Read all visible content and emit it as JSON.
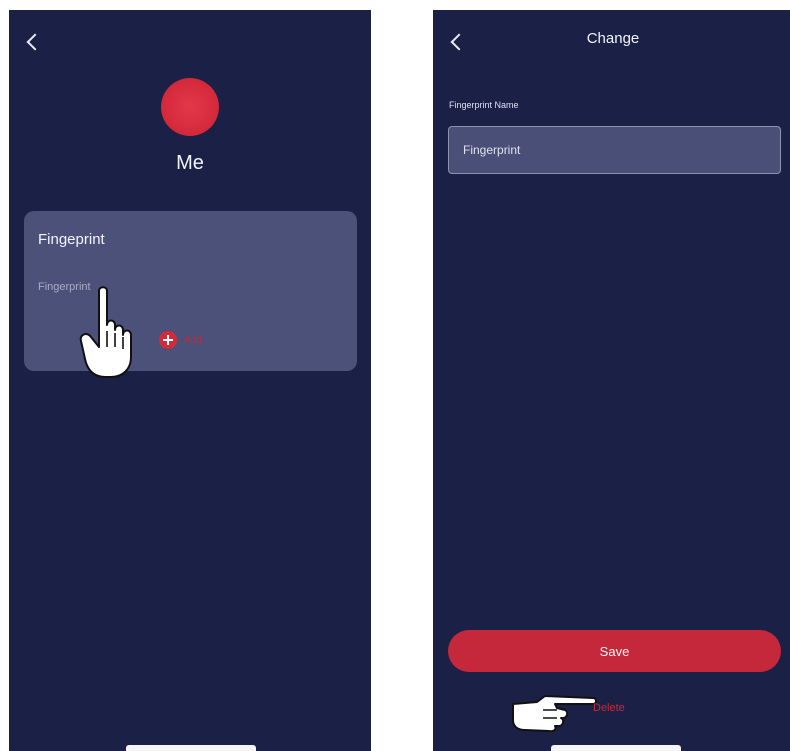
{
  "left_screen": {
    "back_icon": "chevron-left-icon",
    "profile": {
      "name": "Me",
      "avatar_color": "#d72c3d"
    },
    "fingerprint_card": {
      "title": "Fingeprint",
      "items": [
        {
          "label": "Fingerprint"
        }
      ],
      "add_label": "Add"
    },
    "cursor_icon": "pointing-hand-icon"
  },
  "right_screen": {
    "back_icon": "chevron-left-icon",
    "title": "Change",
    "field": {
      "label": "Fingerprint Name",
      "value": "Fingerprint"
    },
    "save_label": "Save",
    "delete_label": "Delete",
    "cursor_icon": "pointing-hand-icon"
  },
  "colors": {
    "background": "#1a2046",
    "card": "#4b5179",
    "accent_red": "#c4283a"
  }
}
